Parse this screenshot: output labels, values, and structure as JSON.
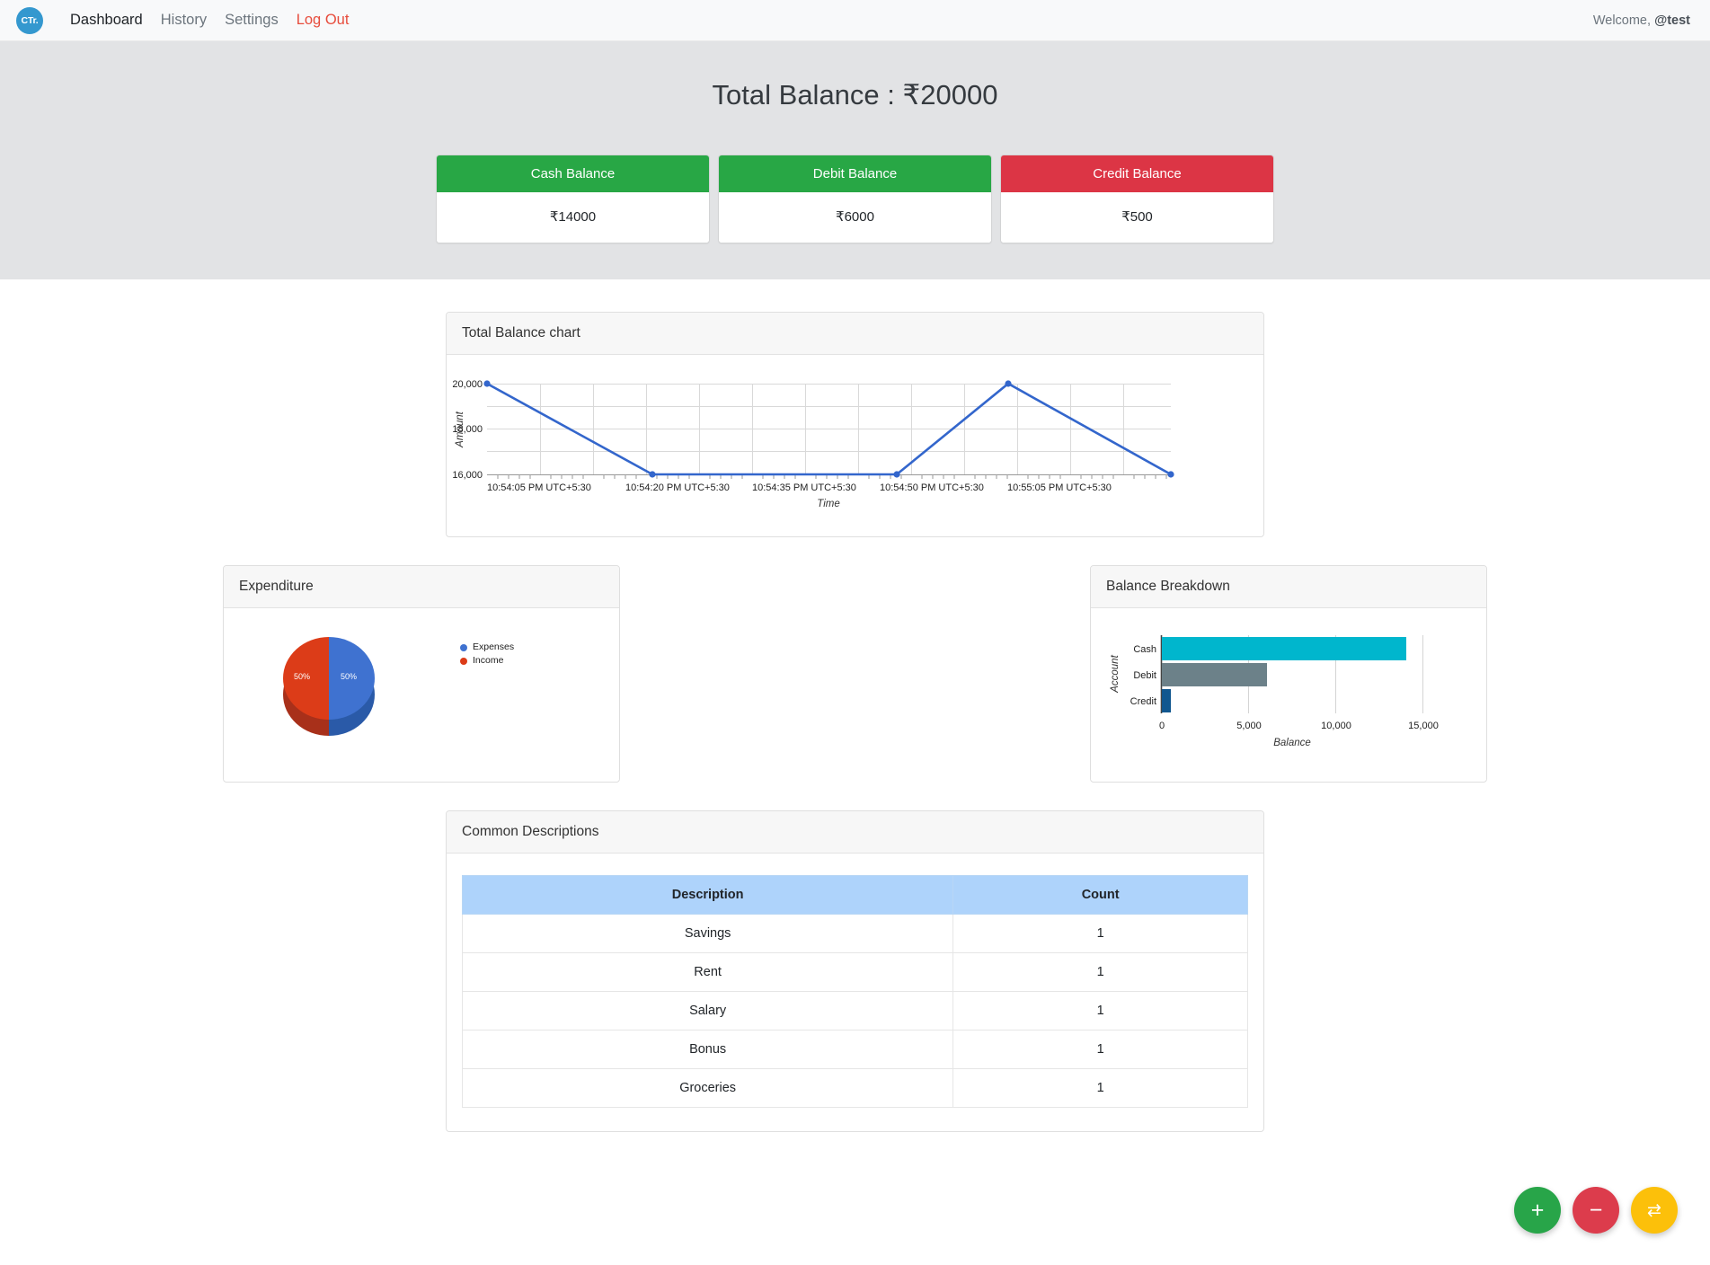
{
  "navbar": {
    "logo_text": "CTr.",
    "links": [
      {
        "label": "Dashboard",
        "state": "active"
      },
      {
        "label": "History",
        "state": "normal"
      },
      {
        "label": "Settings",
        "state": "normal"
      },
      {
        "label": "Log Out",
        "state": "logout"
      }
    ],
    "welcome_prefix": "Welcome, ",
    "welcome_user": "@test"
  },
  "hero": {
    "title": "Total Balance : ₹20000",
    "cards": [
      {
        "label": "Cash Balance",
        "value": "₹14000",
        "color": "#28a745"
      },
      {
        "label": "Debit Balance",
        "value": "₹6000",
        "color": "#28a745"
      },
      {
        "label": "Credit Balance",
        "value": "₹500",
        "color": "#dc3545"
      }
    ]
  },
  "panels": {
    "line_title": "Total Balance chart",
    "pie_title": "Expenditure",
    "bar_title": "Balance Breakdown",
    "table_title": "Common Descriptions"
  },
  "table": {
    "headers": [
      "Description",
      "Count"
    ],
    "rows": [
      {
        "description": "Savings",
        "count": "1"
      },
      {
        "description": "Rent",
        "count": "1"
      },
      {
        "description": "Salary",
        "count": "1"
      },
      {
        "description": "Bonus",
        "count": "1"
      },
      {
        "description": "Groceries",
        "count": "1"
      }
    ]
  },
  "fabs": [
    {
      "name": "add-transaction",
      "glyph": "+",
      "color": "#28a549"
    },
    {
      "name": "remove-transaction",
      "glyph": "−",
      "color": "#dc3c4c"
    },
    {
      "name": "transfer",
      "glyph": "⇄",
      "color": "#fcc00a"
    }
  ],
  "chart_data": [
    {
      "type": "line",
      "title": "Total Balance chart",
      "xlabel": "Time",
      "ylabel": "Amount",
      "ylim": [
        16000,
        20000
      ],
      "yticks": [
        16000,
        18000,
        20000
      ],
      "ytick_labels": [
        "16,000",
        "18,000",
        "20,000"
      ],
      "xtick_labels": [
        "10:54:05 PM UTC+5:30",
        "10:54:20 PM UTC+5:30",
        "10:54:35 PM UTC+5:30",
        "10:54:50 PM UTC+5:30",
        "10:55:05 PM UTC+5:30"
      ],
      "grid": true,
      "legend": "none",
      "series": [
        {
          "name": "Amount",
          "color": "#3366cc",
          "x": [
            "10:54:05",
            "10:54:29",
            "10:55:00",
            "10:55:09",
            "10:55:13"
          ],
          "values": [
            20000,
            16000,
            16000,
            20000,
            16000
          ]
        }
      ]
    },
    {
      "type": "pie",
      "title": "Expenditure",
      "legend": "right",
      "labels": [
        "Expenses",
        "Income"
      ],
      "values": [
        50,
        50
      ],
      "value_labels": [
        "50%",
        "50%"
      ],
      "colors": [
        "#3f72d0",
        "#dc3c18"
      ]
    },
    {
      "type": "bar",
      "title": "Balance Breakdown",
      "orientation": "horizontal",
      "xlabel": "Balance",
      "ylabel": "Account",
      "categories": [
        "Cash",
        "Debit",
        "Credit"
      ],
      "values": [
        14000,
        6000,
        500
      ],
      "colors": [
        "#00b6cd",
        "#6c8189",
        "#11578f"
      ],
      "xlim": [
        0,
        16500
      ],
      "xticks": [
        0,
        5000,
        10000,
        15000
      ],
      "xtick_labels": [
        "0",
        "5,000",
        "10,000",
        "15,000"
      ],
      "grid": true,
      "legend": "none"
    }
  ]
}
